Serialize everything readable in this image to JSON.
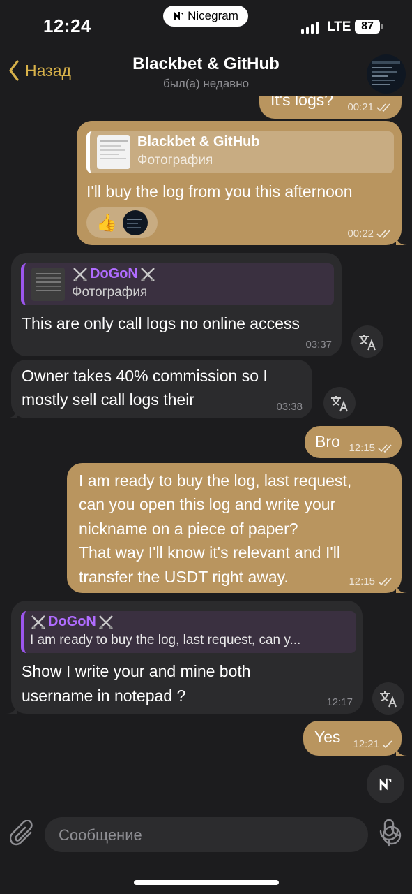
{
  "status_bar": {
    "time": "12:24",
    "app_badge": "Nicegram",
    "network": "LTE",
    "battery": "87"
  },
  "header": {
    "back_label": "Назад",
    "title": "Blackbet & GitHub",
    "subtitle": "был(а) недавно"
  },
  "messages": [
    {
      "text": "It's logs?",
      "time": "00:21"
    },
    {
      "reply_name": "Blackbet & GitHub",
      "reply_sub": "Фотография",
      "text": "I'll buy the log from you this afternoon",
      "reaction": "👍",
      "time": "00:22"
    },
    {
      "reply_name": "DoGoN",
      "reply_sub": "Фотография",
      "text": "This are only call logs no online access",
      "time": "03:37"
    },
    {
      "line1": "Owner takes 40% commission so I",
      "line2": "mostly sell call logs their",
      "time": "03:38"
    },
    {
      "text": "Bro",
      "time": "12:15"
    },
    {
      "lines": [
        "I am ready to buy the log, last request,",
        "can you open this log and write your",
        "nickname on a piece of paper?",
        "That way I'll know it's relevant and I'll",
        "transfer the USDT right away."
      ],
      "time": "12:15"
    },
    {
      "reply_name": "DoGoN",
      "reply_sub": "I am ready to buy the log, last request, can y...",
      "line1": "Show I write your and mine both",
      "line2": "username in notepad ?",
      "time": "12:17"
    },
    {
      "text": "Yes",
      "time": "12:21"
    }
  ],
  "input": {
    "placeholder": "Сообщение"
  },
  "colors": {
    "outgoing_bubble": "#b9955f",
    "incoming_bubble": "#2b2b2d",
    "accent": "#d8b24a",
    "sender_name": "#b06cff"
  },
  "icons": [
    "chevron-left-icon",
    "double-check-icon",
    "single-check-icon",
    "translate-icon",
    "crossed-swords-icon",
    "paperclip-icon",
    "sticker-icon",
    "microphone-icon",
    "nicegram-logo-icon"
  ]
}
